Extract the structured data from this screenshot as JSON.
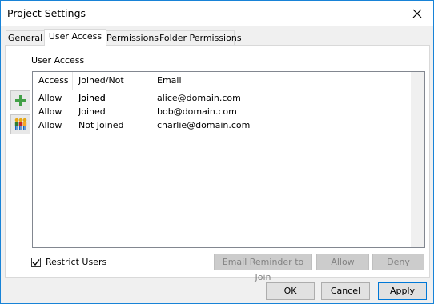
{
  "window": {
    "title": "Project Settings"
  },
  "tabs": [
    {
      "label": "General"
    },
    {
      "label": "User Access"
    },
    {
      "label": "Permissions"
    },
    {
      "label": "Folder Permissions"
    }
  ],
  "user_access": {
    "section_label": "User Access",
    "columns": [
      "Access",
      "Joined/Not Joined",
      "Email"
    ],
    "rows": [
      {
        "access": "Allow",
        "joined": "Joined",
        "email": "alice@domain.com"
      },
      {
        "access": "Allow",
        "joined": "Joined",
        "email": "bob@domain.com"
      },
      {
        "access": "Allow",
        "joined": "Not Joined",
        "email": "charlie@domain.com"
      }
    ],
    "restrict_users_label": "Restrict Users",
    "restrict_users_checked": true,
    "email_reminder_label": "Email Reminder to Join",
    "allow_label": "Allow",
    "deny_label": "Deny"
  },
  "footer": {
    "ok_label": "OK",
    "cancel_label": "Cancel",
    "apply_label": "Apply"
  },
  "colors": {
    "window_border": "#1883d7",
    "accent_plus": "#43a047",
    "primary_border": "#0078d7"
  },
  "icons": {
    "add": "plus-icon",
    "users": "group-icon",
    "close": "close-icon",
    "check": "checkmark-icon"
  }
}
